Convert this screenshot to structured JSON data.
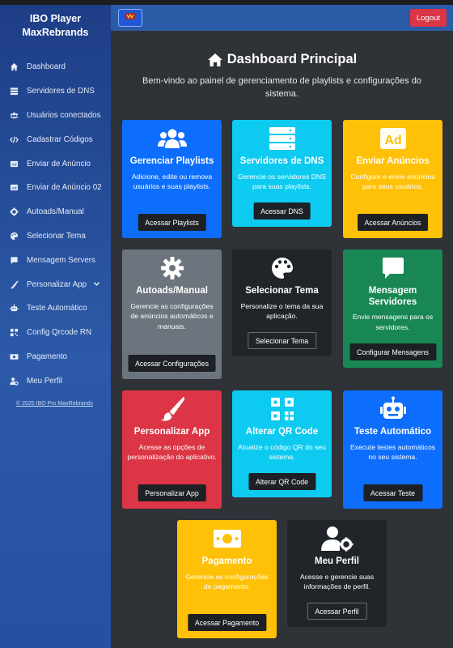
{
  "brand": {
    "line1": "IBO Player",
    "line2": "MaxRebrands"
  },
  "sidebar": {
    "items": [
      {
        "label": "Dashboard",
        "icon": "home-icon"
      },
      {
        "label": "Servidores de DNS",
        "icon": "server-icon"
      },
      {
        "label": "Usuários conectados",
        "icon": "users-icon"
      },
      {
        "label": "Cadastrar Códigos",
        "icon": "code-icon"
      },
      {
        "label": "Enviar de Anúncio",
        "icon": "ad-icon"
      },
      {
        "label": "Enviar de Anúncio 02",
        "icon": "ad-icon"
      },
      {
        "label": "Autoads/Manual",
        "icon": "gear-icon"
      },
      {
        "label": "Selecionar Tema",
        "icon": "palette-icon"
      },
      {
        "label": "Mensagem Servers",
        "icon": "message-icon"
      },
      {
        "label": "Personalizar App",
        "icon": "brush-icon"
      },
      {
        "label": "Teste Automático",
        "icon": "robot-icon"
      },
      {
        "label": "Config Qrcode RN",
        "icon": "qrcode-icon"
      },
      {
        "label": "Pagamento",
        "icon": "money-icon"
      },
      {
        "label": "Meu Perfil",
        "icon": "user-gear-icon"
      }
    ],
    "copyright": "© 2025 IBO Pro MaxRebrands"
  },
  "topbar": {
    "logout_label": "Logout"
  },
  "header": {
    "title": "Dashboard Principal",
    "subtitle": "Bem-vindo ao painel de gerenciamento de playlists e configurações do sistema."
  },
  "colors": {
    "blue": "#0d6efd",
    "cyan": "#0dcaf0",
    "yellow": "#ffc107",
    "gray": "#6c757d",
    "dark": "#212529",
    "green": "#198754",
    "red": "#dc3545",
    "sidebar": "#2b5aa6",
    "logout": "#dc3545"
  },
  "cards": [
    {
      "title": "Gerenciar Playlists",
      "desc": "Adicione, edite ou remova usuários e suas playlists.",
      "button": "Acessar Playlists",
      "icon": "users-icon"
    },
    {
      "title": "Servidores de DNS",
      "desc": "Gerencie os servidores DNS para suas playlists.",
      "button": "Acessar DNS",
      "icon": "server-icon"
    },
    {
      "title": "Enviar Anúncios",
      "desc": "Configure e envie anúncios para seus usuários.",
      "button": "Acessar Anúncios",
      "icon": "ad-icon"
    },
    {
      "title": "Autoads/Manual",
      "desc": "Gerencie as configurações de anúncios automáticos e manuais.",
      "button": "Acessar Configurações",
      "icon": "gear-icon"
    },
    {
      "title": "Selecionar Tema",
      "desc": "Personalize o tema da sua aplicação.",
      "button": "Selecionar Tema",
      "icon": "palette-icon"
    },
    {
      "title": "Mensagem Servidores",
      "desc": "Envie mensagens para os servidores.",
      "button": "Configurar Mensagens",
      "icon": "message-icon"
    },
    {
      "title": "Personalizar App",
      "desc": "Acesse as opções de personalização do aplicativo.",
      "button": "Personalizar App",
      "icon": "brush-icon"
    },
    {
      "title": "Alterar QR Code",
      "desc": "Atualize o código QR do seu sistema.",
      "button": "Alterar QR Code",
      "icon": "qrcode-icon"
    },
    {
      "title": "Teste Automático",
      "desc": "Execute testes automáticos no seu sistema.",
      "button": "Acessar Teste",
      "icon": "robot-icon"
    },
    {
      "title": "Pagamento",
      "desc": "Gerencie as configurações de pagamento.",
      "button": "Acessar Pagamento",
      "icon": "money-icon"
    },
    {
      "title": "Meu Perfil",
      "desc": "Acesse e gerencie suas informações de perfil.",
      "button": "Acessar Perfil",
      "icon": "user-gear-icon"
    }
  ]
}
